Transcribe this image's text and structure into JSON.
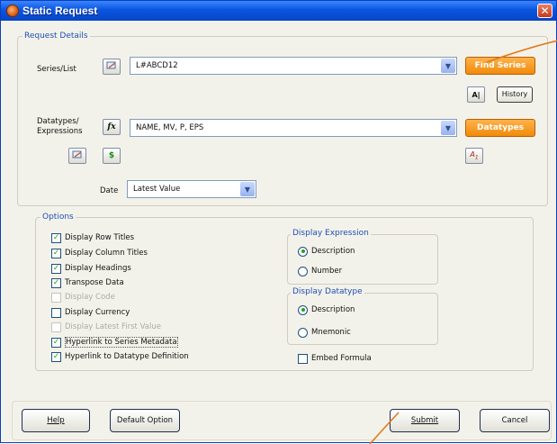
{
  "window": {
    "title": "Static Request",
    "close_glyph": "✕"
  },
  "request_details": {
    "legend": "Request Details",
    "series_label": "Series/List",
    "series_value": "L#ABCD12",
    "find_series_label": "Find Series",
    "history_label": "History",
    "datatypes_label_line1": "Datatypes/",
    "datatypes_label_line2": "Expressions",
    "datatypes_value": "NAME, MV, P, EPS",
    "datatypes_button_label": "Datatypes",
    "fx_glyph": "fx",
    "dollar_glyph": "$",
    "date_label": "Date",
    "date_value": "Latest Value"
  },
  "options": {
    "legend": "Options",
    "checkboxes": [
      {
        "label": "Display Row Titles",
        "checked": true,
        "enabled": true
      },
      {
        "label": "Display Column Titles",
        "checked": true,
        "enabled": true
      },
      {
        "label": "Display Headings",
        "checked": true,
        "enabled": true
      },
      {
        "label": "Transpose Data",
        "checked": true,
        "enabled": true
      },
      {
        "label": "Display Code",
        "checked": false,
        "enabled": false
      },
      {
        "label": "Display Currency",
        "checked": false,
        "enabled": true
      },
      {
        "label": "Display Latest First Value",
        "checked": false,
        "enabled": false
      },
      {
        "label": "Hyperlink to Series Metadata",
        "checked": true,
        "enabled": true
      },
      {
        "label": "Hyperlink to Datatype Definition",
        "checked": true,
        "enabled": true
      }
    ],
    "display_expression": {
      "legend": "Display Expression",
      "options": [
        {
          "label": "Description",
          "selected": true
        },
        {
          "label": "Number",
          "selected": false
        }
      ]
    },
    "display_datatype": {
      "legend": "Display Datatype",
      "options": [
        {
          "label": "Description",
          "selected": true
        },
        {
          "label": "Mnemonic",
          "selected": false
        }
      ]
    },
    "embed_formula": {
      "label": "Embed Formula",
      "checked": false
    }
  },
  "footer": {
    "help_label": "Help",
    "default_option_label": "Default Option",
    "submit_label": "Submit",
    "cancel_label": "Cancel"
  },
  "colors": {
    "accent_orange": "#f18a0b",
    "title_blue": "#0a55e0",
    "legend_blue": "#1d4fb6",
    "check_green": "#21a121",
    "annotation": "#e07a1a"
  },
  "icons": [
    "app-icon",
    "close-icon",
    "edit-list-icon",
    "fx-icon",
    "dollar-icon",
    "chevron-down-icon",
    "text-icon"
  ]
}
